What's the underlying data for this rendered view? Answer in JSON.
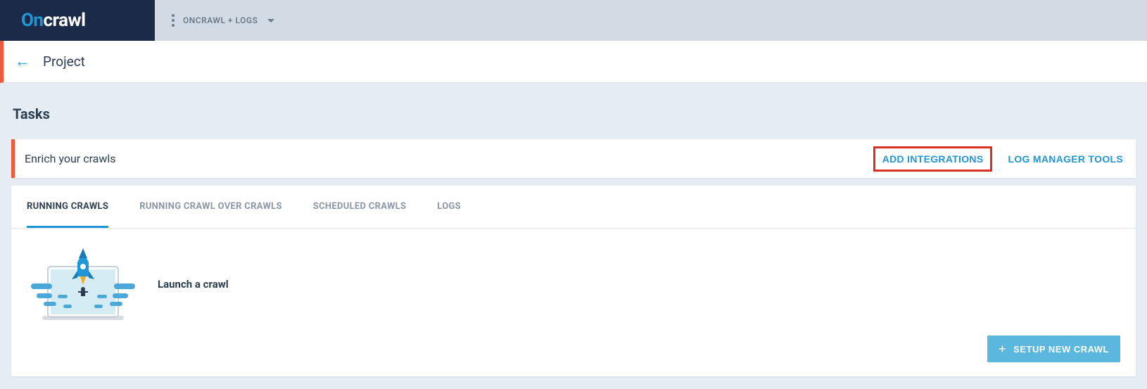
{
  "header": {
    "logo_part1": "On",
    "logo_part2": "crawl",
    "project_selector_label": "ONCRAWL + LOGS"
  },
  "project": {
    "title": "Project"
  },
  "tasks": {
    "section_title": "Tasks",
    "enrich": {
      "label": "Enrich your crawls",
      "add_integrations": "ADD INTEGRATIONS",
      "log_manager_tools": "LOG MANAGER TOOLS"
    },
    "tabs": [
      {
        "label": "RUNNING CRAWLS",
        "active": true
      },
      {
        "label": "RUNNING CRAWL OVER CRAWLS",
        "active": false
      },
      {
        "label": "SCHEDULED CRAWLS",
        "active": false
      },
      {
        "label": "LOGS",
        "active": false
      }
    ],
    "launch_label": "Launch a crawl",
    "setup_button": "SETUP NEW CRAWL"
  }
}
